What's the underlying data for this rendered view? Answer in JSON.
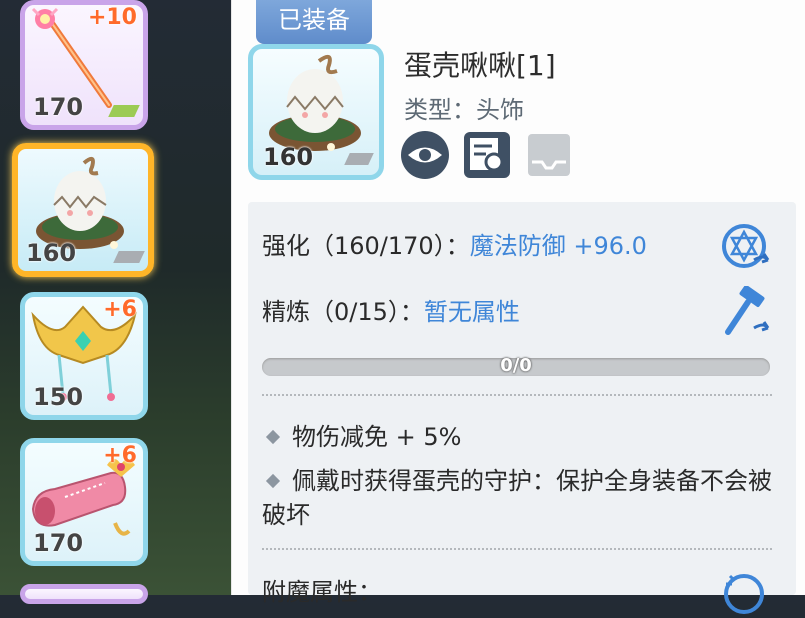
{
  "sidebar": {
    "slots": [
      {
        "level": "170",
        "plus": "+10",
        "icon": "staff-icon",
        "tag_color": "#9ccb54"
      },
      {
        "level": "160",
        "plus": "",
        "icon": "egg-nest-icon",
        "tag_color": "#a9adb2",
        "selected": true
      },
      {
        "level": "150",
        "plus": "+6",
        "icon": "golden-crown-icon"
      },
      {
        "level": "170",
        "plus": "+6",
        "icon": "pink-cannon-icon"
      }
    ]
  },
  "detail": {
    "equipped_label": "已装备",
    "item": {
      "name": "蛋壳啾啾[1]",
      "type": "类型：头饰",
      "level": "160",
      "icon": "egg-nest-icon"
    },
    "action_icons": [
      "eye-icon",
      "inspect-icon",
      "slot-tray-icon"
    ],
    "refine_stats": {
      "enhance_label": "强化（160/170）：",
      "enhance_value": "魔法防御 +96.0",
      "refine_label": "精炼（0/15）：",
      "refine_value": "暂无属性",
      "progress_text": "0/0",
      "progress": 0
    },
    "attributes": [
      "物伤减免 + 5%",
      "佩戴时获得蛋壳的守护：保护全身装备不会被破坏"
    ],
    "enchant_label": "附魔属性："
  },
  "colors": {
    "accent_blue": "#3f86d8",
    "selected_border": "#ffb528",
    "equipped_tab": "#6a96d2"
  }
}
